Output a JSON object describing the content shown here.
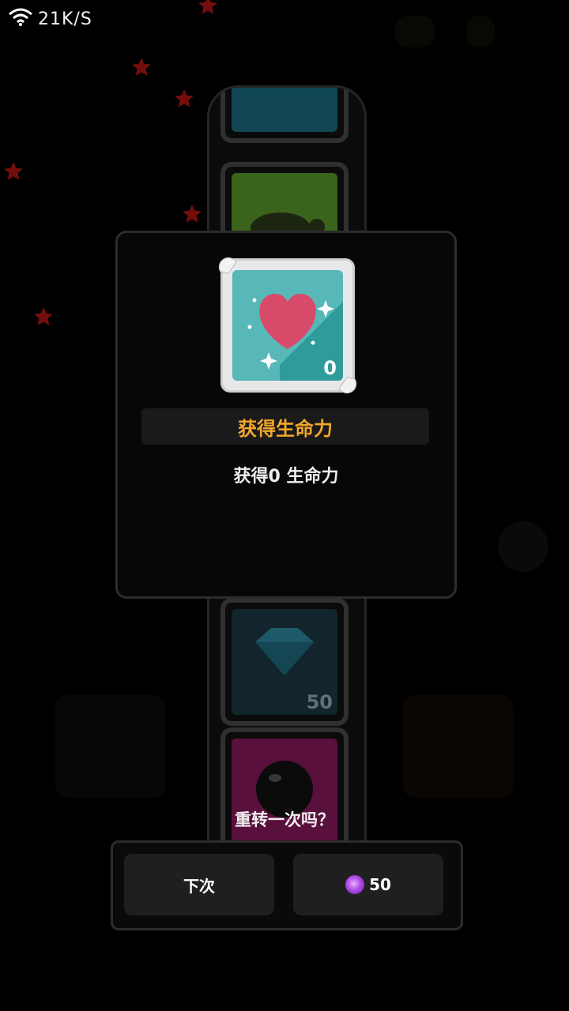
{
  "status_bar": {
    "wifi_icon": "wifi-icon",
    "network_speed": "21K/S"
  },
  "slot_strip": {
    "visible_items": [
      {
        "icon": "turtle-icon",
        "color": "#5a9a2a"
      },
      {
        "icon": "diamond-icon",
        "color": "#1e3a44",
        "count": "50"
      },
      {
        "icon": "black-orb-icon",
        "color": "#8a1a5e"
      }
    ]
  },
  "dialog": {
    "reward_icon": "heart-icon",
    "reward_count": "0",
    "title": "获得生命力",
    "description": "获得0 生命力"
  },
  "respin": {
    "question": "重转一次吗？",
    "next_label": "下次",
    "cost_icon": "purple-orb-icon",
    "cost_value": "50"
  },
  "colors": {
    "title": "#f3a72b",
    "card_face": "#58b7b7",
    "heart": "#d84a6a"
  }
}
